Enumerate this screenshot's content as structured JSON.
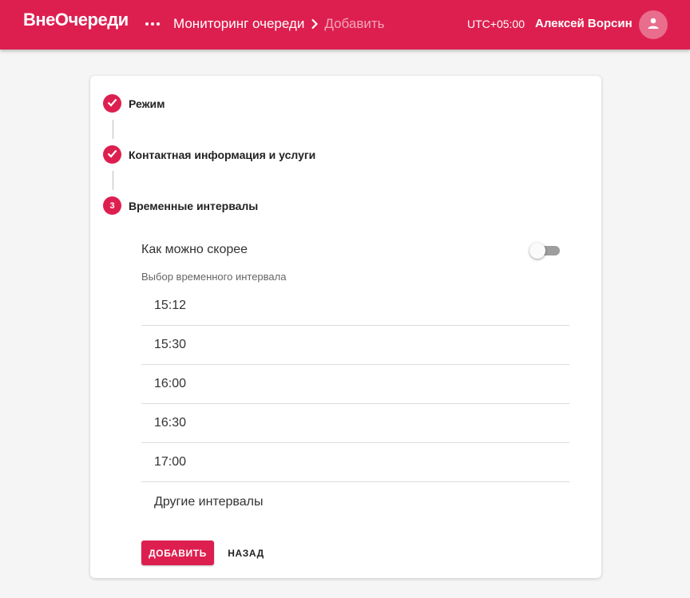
{
  "header": {
    "logo": "ВнеОчереди",
    "breadcrumb": {
      "current": "Мониторинг очереди",
      "next": "Добавить"
    },
    "timezone": "UTC+05:00",
    "user_name": "Алексей Ворсин"
  },
  "stepper": {
    "steps": [
      {
        "label": "Режим",
        "state": "done"
      },
      {
        "label": "Контактная информация и услуги",
        "state": "done"
      },
      {
        "label": "Временные интервалы",
        "state": "active",
        "number": "3"
      }
    ]
  },
  "time_step": {
    "asap_label": "Как можно скорее",
    "asap_enabled": false,
    "interval_label": "Выбор временного интервала",
    "intervals": [
      "15:12",
      "15:30",
      "16:00",
      "16:30",
      "17:00",
      "Другие интервалы"
    ]
  },
  "actions": {
    "add": "ДОБАВИТЬ",
    "back": "НАЗАД"
  },
  "colors": {
    "accent": "#dd1f4f",
    "background": "#f5f5f5",
    "card": "#ffffff"
  },
  "icons": {
    "menu": "more-horizontal-icon",
    "chevron": "chevron-right-icon",
    "check": "check-icon",
    "avatar": "user-icon"
  }
}
